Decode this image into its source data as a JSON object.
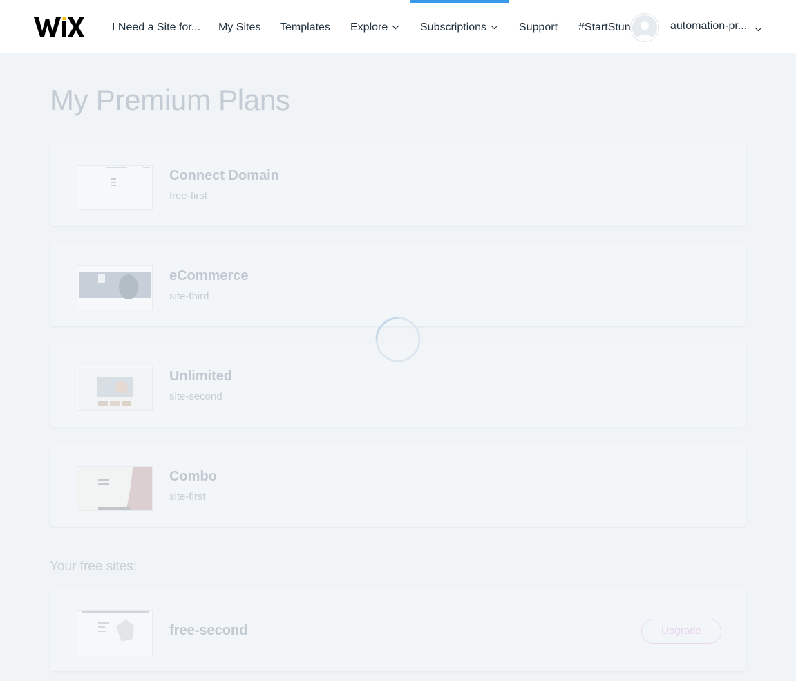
{
  "header": {
    "logo_text": "WIX",
    "nav": {
      "need_site": "I Need a Site for...",
      "my_sites": "My Sites",
      "templates": "Templates",
      "explore": "Explore",
      "subscriptions": "Subscriptions",
      "support": "Support",
      "start_stunning": "#StartStunning"
    },
    "active_tab": "Subscriptions",
    "user": {
      "name": "automation-pr..."
    }
  },
  "main": {
    "title": "My Premium Plans",
    "premium_sites": [
      {
        "plan": "Connect Domain",
        "site": "free-first",
        "thumb_icon": "site-thumbnail-blank"
      },
      {
        "plan": "eCommerce",
        "site": "site-third",
        "thumb_icon": "site-thumbnail-hero"
      },
      {
        "plan": "Unlimited",
        "site": "site-second",
        "thumb_icon": "site-thumbnail-gallery"
      },
      {
        "plan": "Combo",
        "site": "site-first",
        "thumb_icon": "site-thumbnail-photo"
      }
    ],
    "free_section_title": "Your free sites:",
    "free_sites": [
      {
        "site": "free-second",
        "button": "Upgrade",
        "thumb_icon": "site-thumbnail-product"
      }
    ],
    "loading": true
  },
  "colors": {
    "accent": "#3899ec",
    "upgrade": "#a845c2",
    "text": "#20303c",
    "background_overlay": "#f0f4f7"
  }
}
